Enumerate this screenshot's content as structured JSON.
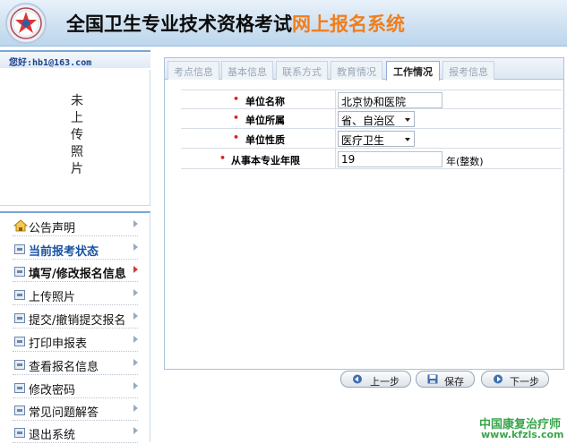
{
  "header": {
    "title_main": "全国卫生专业技术资格考试",
    "title_highlight": "网上报名系统"
  },
  "user": {
    "greeting": "您好:hb1@163.com"
  },
  "photo": {
    "placeholder": "未上传照片"
  },
  "menu": {
    "items": [
      {
        "label": "公告声明"
      },
      {
        "label": "当前报考状态"
      },
      {
        "label": "填写/修改报名信息"
      },
      {
        "label": "上传照片"
      },
      {
        "label": "提交/撤销提交报名"
      },
      {
        "label": "打印申报表"
      },
      {
        "label": "查看报名信息"
      },
      {
        "label": "修改密码"
      },
      {
        "label": "常见问题解答"
      },
      {
        "label": "退出系统"
      }
    ]
  },
  "tabs": [
    {
      "label": "考点信息"
    },
    {
      "label": "基本信息"
    },
    {
      "label": "联系方式"
    },
    {
      "label": "教育情况"
    },
    {
      "label": "工作情况",
      "active": true
    },
    {
      "label": "报考信息"
    }
  ],
  "form": {
    "unit_name": {
      "label": "单位名称",
      "value": "北京协和医院"
    },
    "unit_belong": {
      "label": "单位所属",
      "value": "省、自治区"
    },
    "unit_nature": {
      "label": "单位性质",
      "value": "医疗卫生"
    },
    "years": {
      "label": "从事本专业年限",
      "value": "19",
      "unit": "年(整数)"
    }
  },
  "buttons": {
    "prev": "上一步",
    "save": "保存",
    "next": "下一步"
  },
  "watermark": {
    "line1": "中国康复治疗师",
    "line2": "www.kfzls.com"
  },
  "colors": {
    "accent": "#f07e1d",
    "link_blue": "#1a52a3",
    "required": "#d22222",
    "watermark": "#3aa54a"
  }
}
